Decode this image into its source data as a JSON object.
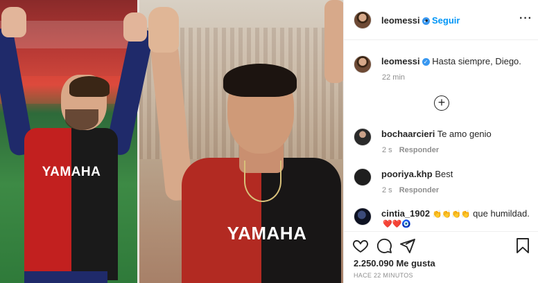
{
  "photo": {
    "left_jersey_text": "YAMAHA",
    "right_jersey_text": "YAMAHA"
  },
  "header": {
    "username": "leomessi",
    "separator": "•",
    "follow_label": "Seguir",
    "more_label": "···"
  },
  "caption": {
    "username": "leomessi",
    "text": "Hasta siempre, Diego.",
    "time": "22 min"
  },
  "load_more_label": "+",
  "comments": [
    {
      "username": "bochaarcieri",
      "text": "Te amo genio",
      "time": "2 s",
      "reply_label": "Responder"
    },
    {
      "username": "pooriya.khp",
      "text": "Best",
      "time": "2 s",
      "reply_label": "Responder"
    },
    {
      "username": "cintia_1902",
      "emoji": "👏👏👏👏",
      "text": "que humildad.",
      "emoji2": "❤️❤️🧿"
    }
  ],
  "footer": {
    "likes": "2.250.090 Me gusta",
    "time_ago": "HACE 22 MINUTOS"
  },
  "colors": {
    "link_blue": "#0095f6",
    "verified_blue": "#3897f0",
    "text": "#262626",
    "muted": "#8e8e8e"
  }
}
